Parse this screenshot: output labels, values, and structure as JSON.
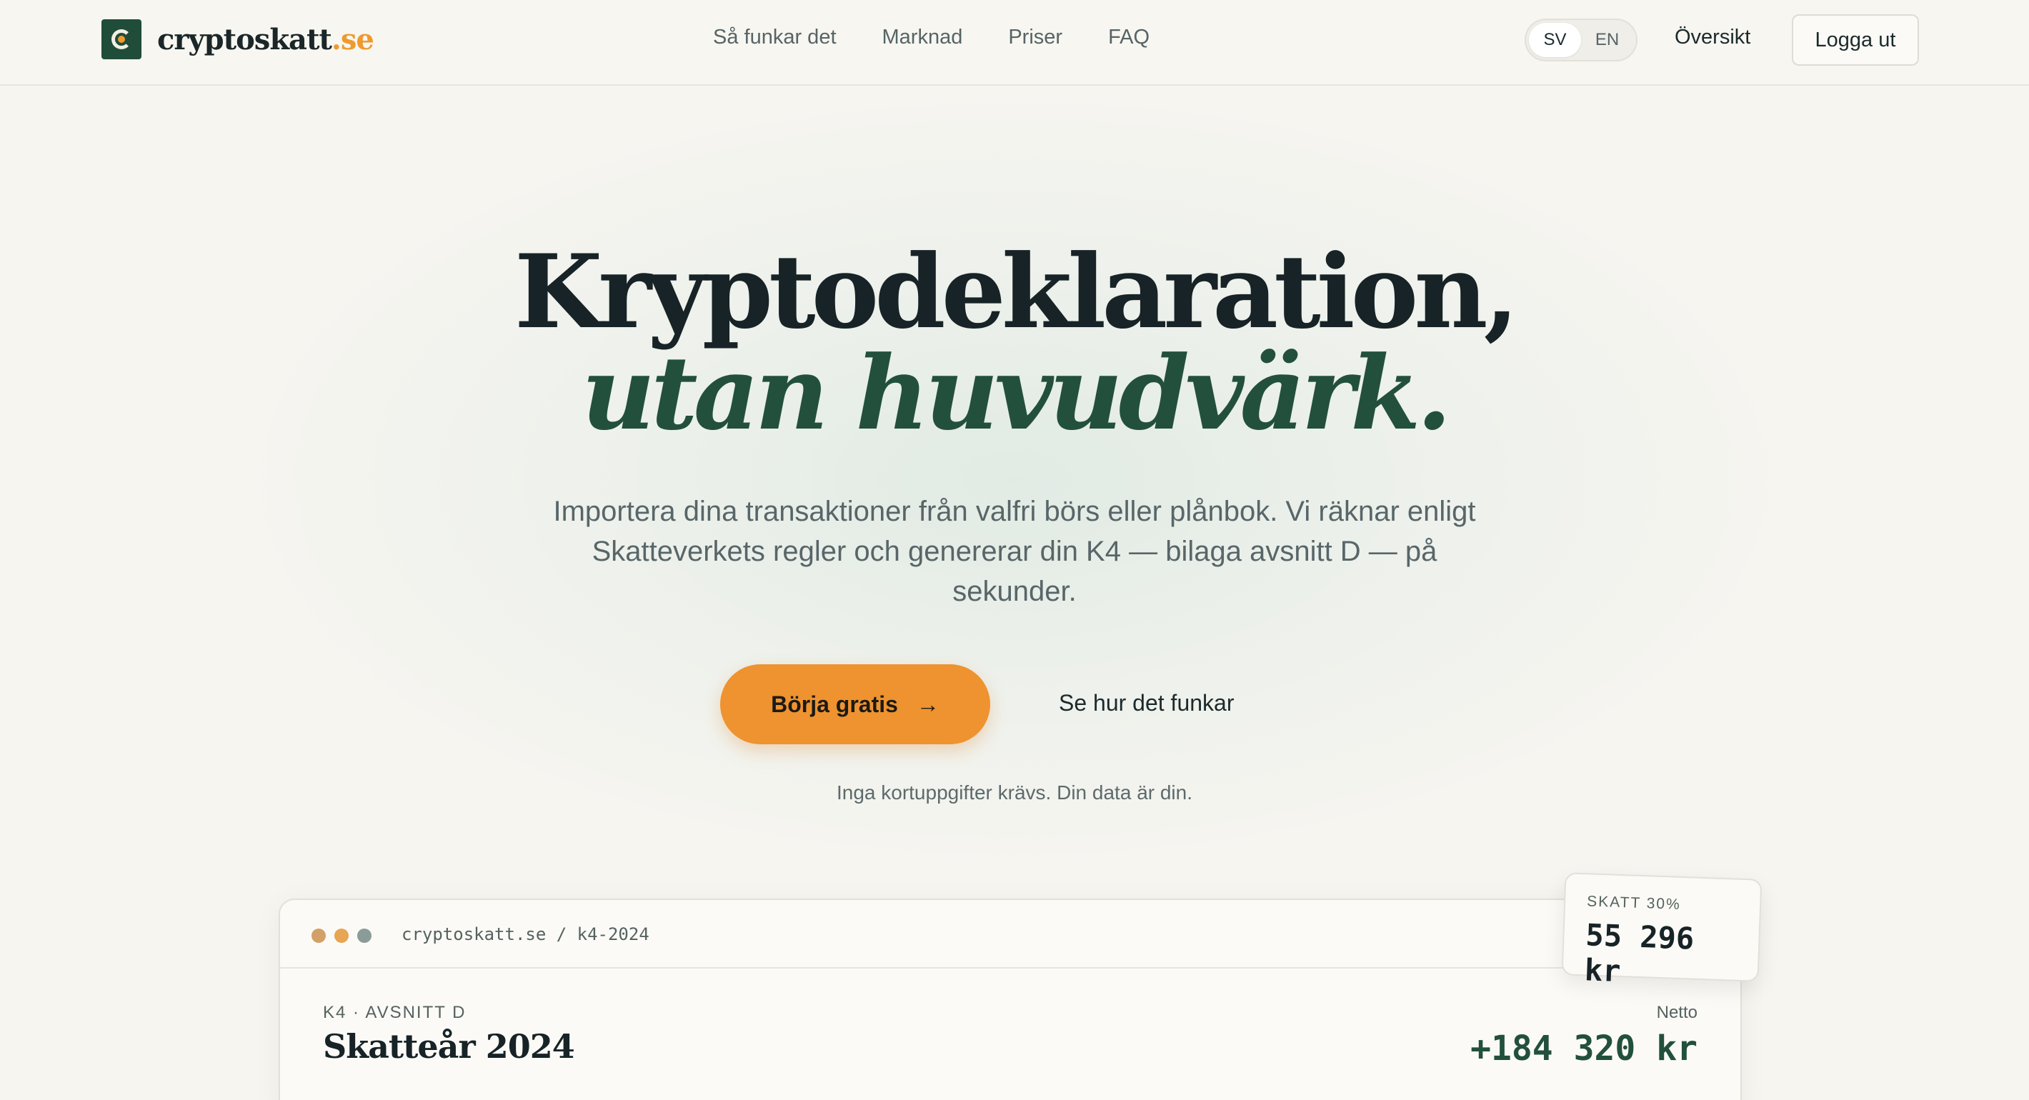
{
  "brand": {
    "name": "cryptoskatt",
    "tld": ".se",
    "accent": "#ee9330",
    "primary": "#22503c",
    "logo_icon": "logo-c-icon"
  },
  "nav": {
    "links": [
      "Så funkar det",
      "Marknad",
      "Priser",
      "FAQ"
    ],
    "lang": {
      "sv": "SV",
      "en": "EN",
      "active": "SV"
    },
    "overview": "Översikt",
    "logout": "Logga ut"
  },
  "hero": {
    "title_line1": "Kryptodeklaration,",
    "title_line2": "utan huvudvärk.",
    "subtitle": "Importera dina transaktioner från valfri börs eller plånbok. Vi räknar enligt Skatteverkets regler och genererar din K4 — bilaga avsnitt D — på sekunder.",
    "cta_primary": "Börja gratis",
    "cta_arrow": "→",
    "cta_secondary": "Se hur det funkar",
    "note": "Inga kortuppgifter krävs. Din data är din."
  },
  "preview": {
    "url": "cryptoskatt.se / k4-2024",
    "dot_colors": [
      "#d3a067",
      "#e8a552",
      "#8b9c98"
    ],
    "section_label": "K4 · AVSNITT D",
    "tax_year": "Skatteår 2024",
    "netto_label": "Netto",
    "netto_value": "+184 320 kr",
    "tax_badge_label": "SKATT 30%",
    "tax_badge_value": "55 296 kr"
  }
}
